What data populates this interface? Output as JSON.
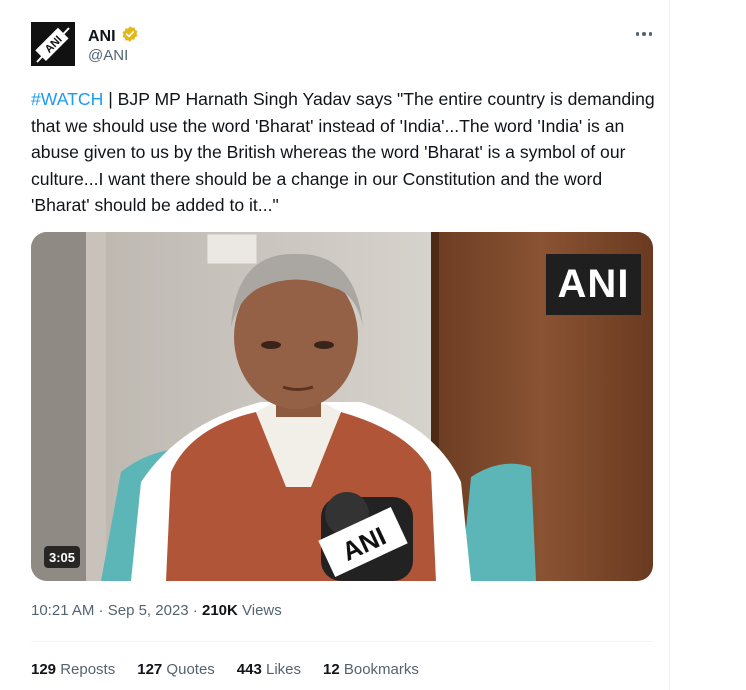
{
  "author": {
    "name": "ANI",
    "handle": "@ANI",
    "avatar_text": "ANI",
    "verified_icon": "verified-badge-icon"
  },
  "more_icon": "more-dots-icon",
  "tweet": {
    "hashtag": "#WATCH",
    "body": " | BJP MP Harnath Singh Yadav says \"The entire country is demanding that we should use the word 'Bharat' instead of 'India'...The word 'India' is an abuse given to us by the British whereas the word 'Bharat' is a symbol of our culture...I want there should be a change in our Constitution and the word 'Bharat' should be added to it...\""
  },
  "media": {
    "watermark": "ANI",
    "mic_logo": "ANI",
    "duration": "3:05"
  },
  "meta": {
    "time": "10:21 AM",
    "sep1": " · ",
    "date": "Sep 5, 2023",
    "sep2": " · ",
    "views_count": "210K",
    "views_label": " Views"
  },
  "stats": [
    {
      "count": "129",
      "label": " Reposts"
    },
    {
      "count": "127",
      "label": " Quotes"
    },
    {
      "count": "443",
      "label": " Likes"
    },
    {
      "count": "12",
      "label": " Bookmarks"
    }
  ],
  "colors": {
    "accent": "#1d9bf0",
    "verified_gold": "#e2b719",
    "text_primary": "#0f1419",
    "text_secondary": "#536471"
  }
}
